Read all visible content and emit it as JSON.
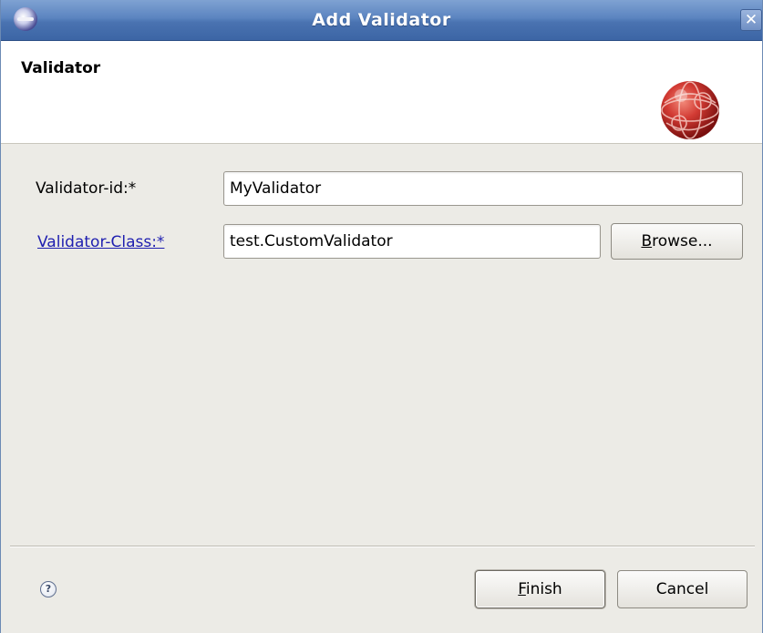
{
  "window": {
    "title": "Add Validator"
  },
  "banner": {
    "title": "Validator"
  },
  "form": {
    "validator_id": {
      "label": "Validator-id:*",
      "value": "MyValidator"
    },
    "validator_class": {
      "label": "Validator-Class:*",
      "value": "test.CustomValidator"
    },
    "browse": {
      "mnemonic": "B",
      "rest": "rowse..."
    }
  },
  "footer": {
    "help_glyph": "?",
    "finish": {
      "mnemonic": "F",
      "rest": "inish"
    },
    "cancel_label": "Cancel"
  },
  "titlebar": {
    "close_glyph": "✕"
  },
  "icons": {
    "app": "eclipse-icon",
    "close": "close-icon",
    "banner": "validator-sphere-icon",
    "help": "help-icon"
  },
  "colors": {
    "titlebar": "#4a73b1",
    "link": "#1f1fb0",
    "dialog_bg": "#ecebe6",
    "sphere": "#c8302c"
  }
}
